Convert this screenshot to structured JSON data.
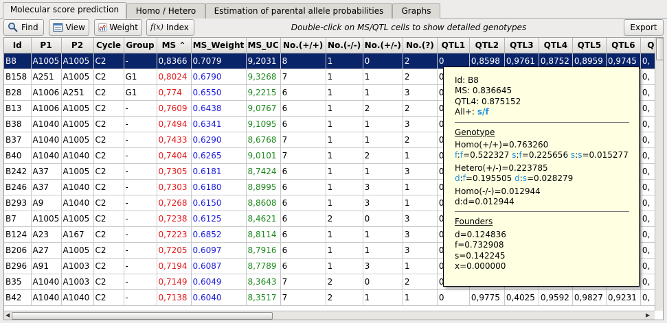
{
  "tabs": [
    {
      "label": "Molecular score prediction",
      "active": true
    },
    {
      "label": "Homo / Hetero",
      "active": false
    },
    {
      "label": "Estimation of parental allele probabilities",
      "active": false
    },
    {
      "label": "Graphs",
      "active": false
    }
  ],
  "toolbar": {
    "find_label": "Find",
    "view_label": "View",
    "weight_label": "Weight",
    "index_label": "Index",
    "hint": "Double-click on MS/QTL cells to show detailed genotypes",
    "export_label": "Export",
    "icons": [
      "search-icon",
      "view-icon",
      "weight-chart-icon",
      "function-icon"
    ]
  },
  "table": {
    "sort_column": "MS",
    "sort_direction": "descending",
    "columns": [
      "Id",
      "P1",
      "P2",
      "Cycle",
      "Group",
      "MS",
      "MS_Weight",
      "MS_UC",
      "No.(+/+)",
      "No.(-/-)",
      "No.(+/-)",
      "No.(?)",
      "QTL1",
      "QTL2",
      "QTL3",
      "QTL4",
      "QTL5",
      "QTL6",
      "Q"
    ],
    "rows": [
      [
        "B8",
        "A1005",
        "A1005",
        "C2",
        "-",
        "0,8366",
        "0.7079",
        "9,2031",
        "8",
        "1",
        "0",
        "2",
        "0",
        "0,8598",
        "0,9761",
        "0,8752",
        "0,8959",
        "0,9745",
        "0,"
      ],
      [
        "B158",
        "A251",
        "A1005",
        "C2",
        "G1",
        "0,8024",
        "0.6790",
        "9,3268",
        "7",
        "1",
        "1",
        "2",
        "0",
        "",
        "",
        "",
        "",
        "",
        "0,"
      ],
      [
        "B28",
        "A1006",
        "A251",
        "C2",
        "G1",
        "0,774",
        "0.6550",
        "9,2215",
        "6",
        "1",
        "1",
        "3",
        "0",
        "",
        "",
        "",
        "",
        "",
        "0,"
      ],
      [
        "B13",
        "A1006",
        "A1005",
        "C2",
        "-",
        "0,7609",
        "0.6438",
        "9,0767",
        "6",
        "1",
        "2",
        "2",
        "0",
        "",
        "",
        "",
        "",
        "",
        "0,"
      ],
      [
        "B38",
        "A1040",
        "A1005",
        "C2",
        "-",
        "0,7494",
        "0.6341",
        "9,1095",
        "6",
        "1",
        "1",
        "3",
        "0",
        "",
        "",
        "",
        "",
        "",
        "0,"
      ],
      [
        "B37",
        "A1040",
        "A1005",
        "C2",
        "-",
        "0,7433",
        "0.6290",
        "8,6768",
        "7",
        "1",
        "1",
        "2",
        "0",
        "",
        "",
        "",
        "",
        "",
        "0,"
      ],
      [
        "B40",
        "A1040",
        "A1040",
        "C2",
        "-",
        "0,7404",
        "0.6265",
        "9,0101",
        "7",
        "1",
        "2",
        "1",
        "0",
        "",
        "",
        "",
        "",
        "",
        "0,"
      ],
      [
        "B242",
        "A37",
        "A1005",
        "C2",
        "-",
        "0,7305",
        "0.6181",
        "8,7424",
        "6",
        "1",
        "1",
        "3",
        "0",
        "",
        "",
        "",
        "",
        "",
        "0,"
      ],
      [
        "B246",
        "A37",
        "A1040",
        "C2",
        "-",
        "0,7303",
        "0.6180",
        "8,8995",
        "6",
        "1",
        "3",
        "1",
        "0",
        "",
        "",
        "",
        "",
        "",
        "0,"
      ],
      [
        "B293",
        "A9",
        "A1040",
        "C2",
        "-",
        "0,7268",
        "0.6150",
        "8,8608",
        "6",
        "1",
        "3",
        "1",
        "0",
        "",
        "",
        "",
        "",
        "",
        "0,"
      ],
      [
        "B7",
        "A1005",
        "A1005",
        "C2",
        "-",
        "0,7238",
        "0.6125",
        "8,4621",
        "6",
        "2",
        "0",
        "3",
        "0",
        "",
        "",
        "",
        "",
        "",
        "0,"
      ],
      [
        "B124",
        "A23",
        "A167",
        "C2",
        "-",
        "0,7223",
        "0.6852",
        "8,8114",
        "6",
        "1",
        "1",
        "3",
        "0",
        "",
        "",
        "",
        "",
        "",
        "0,"
      ],
      [
        "B206",
        "A27",
        "A1005",
        "C2",
        "-",
        "0,7205",
        "0.6097",
        "8,7916",
        "6",
        "1",
        "1",
        "3",
        "0",
        "",
        "",
        "",
        "",
        "",
        "0,"
      ],
      [
        "B296",
        "A91",
        "A1003",
        "C2",
        "-",
        "0,7194",
        "0.6087",
        "8,7789",
        "6",
        "1",
        "3",
        "1",
        "0",
        "",
        "",
        "",
        "",
        "",
        "0,"
      ],
      [
        "B35",
        "A1040",
        "A1003",
        "C2",
        "-",
        "0,7149",
        "0.6049",
        "8,3643",
        "7",
        "2",
        "0",
        "2",
        "0",
        "",
        "",
        "",
        "",
        "",
        "0,"
      ],
      [
        "B42",
        "A1040",
        "A1040",
        "C2",
        "-",
        "0,7138",
        "0.6040",
        "8,3517",
        "7",
        "2",
        "1",
        "1",
        "0",
        "0,9775",
        "0,4025",
        "0,9592",
        "0,9827",
        "0,9231",
        "0,"
      ]
    ]
  },
  "tooltip": {
    "id_line": "Id: B8",
    "ms_line": "MS: 0.836645",
    "qtl_line": "QTL4: 0.875152",
    "all_prefix": "All+:",
    "all_value": "s/f",
    "genotype_title": "Genotype",
    "homo_pp": "Homo(+/+)=0.763260",
    "ff_a": "f",
    ":ff_b": "",
    "pair1": [
      {
        "k1": "f",
        "k2": "f",
        "v": "0.522327"
      },
      {
        "k1": "s",
        "k2": "f",
        "v": "0.225656"
      },
      {
        "k1": "s",
        "k2": "s",
        "v": "0.015277"
      }
    ],
    "hetero": "Hetero(+/-)=0.223785",
    "pair2": [
      {
        "k1": "d",
        "k2": "f",
        "v": "0.195505"
      },
      {
        "k1": "d",
        "k2": "s",
        "v": "0.028279"
      }
    ],
    "homo_mm": "Homo(-/-)=0.012944",
    "dd_line": "d:d=0.012944",
    "founders_title": "Founders",
    "founders": [
      "d=0.124836",
      "f=0.732908",
      "s=0.142245",
      "x=0.000000"
    ]
  },
  "colors": {
    "selection": "#0a246a",
    "ms": "#e31a1a",
    "ms_weight": "#1a1adb",
    "ms_uc": "#1f8a1f",
    "tooltip_bg": "#ffffe1",
    "founder_highlight": "#1c8fe0"
  }
}
